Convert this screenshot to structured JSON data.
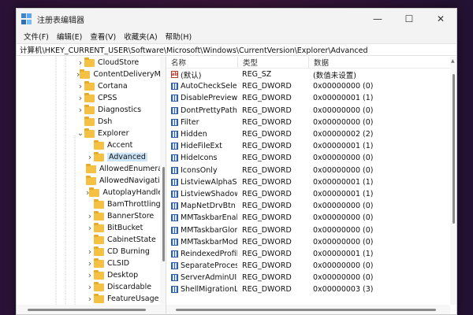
{
  "window": {
    "title": "注册表编辑器",
    "controls": {
      "minimize": "—",
      "maximize": "☐",
      "close": "✕"
    }
  },
  "menu": [
    "文件(F)",
    "编辑(E)",
    "查看(V)",
    "收藏夹(A)",
    "帮助(H)"
  ],
  "address": "计算机\\HKEY_CURRENT_USER\\Software\\Microsoft\\Windows\\CurrentVersion\\Explorer\\Advanced",
  "tree": [
    {
      "label": "CloudStore",
      "level": 0,
      "chevron": "right"
    },
    {
      "label": "ContentDeliveryManager",
      "level": 0,
      "chevron": "right"
    },
    {
      "label": "Cortana",
      "level": 0,
      "chevron": "right"
    },
    {
      "label": "CPSS",
      "level": 0,
      "chevron": "right"
    },
    {
      "label": "Diagnostics",
      "level": 0,
      "chevron": "right"
    },
    {
      "label": "Dsh",
      "level": 0,
      "chevron": "none"
    },
    {
      "label": "Explorer",
      "level": 0,
      "chevron": "down"
    },
    {
      "label": "Accent",
      "level": 1,
      "chevron": "none"
    },
    {
      "label": "Advanced",
      "level": 1,
      "chevron": "right",
      "selected": true
    },
    {
      "label": "AllowedEnumeration",
      "level": 1,
      "chevron": "none"
    },
    {
      "label": "AllowedNavigation",
      "level": 1,
      "chevron": "none"
    },
    {
      "label": "AutoplayHandlers",
      "level": 1,
      "chevron": "right"
    },
    {
      "label": "BamThrottling",
      "level": 1,
      "chevron": "none"
    },
    {
      "label": "BannerStore",
      "level": 1,
      "chevron": "right"
    },
    {
      "label": "BitBucket",
      "level": 1,
      "chevron": "right"
    },
    {
      "label": "CabinetState",
      "level": 1,
      "chevron": "none"
    },
    {
      "label": "CD Burning",
      "level": 1,
      "chevron": "right"
    },
    {
      "label": "CLSID",
      "level": 1,
      "chevron": "right"
    },
    {
      "label": "Desktop",
      "level": 1,
      "chevron": "right"
    },
    {
      "label": "Discardable",
      "level": 1,
      "chevron": "right"
    },
    {
      "label": "FeatureUsage",
      "level": 1,
      "chevron": "right"
    }
  ],
  "list": {
    "headers": {
      "name": "名称",
      "type": "类型",
      "data": "数据"
    },
    "rows": [
      {
        "name": "(默认)",
        "type": "REG_SZ",
        "data": "(数值未设置)",
        "kind": "sz"
      },
      {
        "name": "AutoCheckSelect",
        "type": "REG_DWORD",
        "data": "0x00000000 (0)",
        "kind": "dword"
      },
      {
        "name": "DisablePreviewDesktop",
        "type": "REG_DWORD",
        "data": "0x00000001 (1)",
        "kind": "dword"
      },
      {
        "name": "DontPrettyPath",
        "type": "REG_DWORD",
        "data": "0x00000000 (0)",
        "kind": "dword"
      },
      {
        "name": "Filter",
        "type": "REG_DWORD",
        "data": "0x00000000 (0)",
        "kind": "dword"
      },
      {
        "name": "Hidden",
        "type": "REG_DWORD",
        "data": "0x00000002 (2)",
        "kind": "dword"
      },
      {
        "name": "HideFileExt",
        "type": "REG_DWORD",
        "data": "0x00000001 (1)",
        "kind": "dword"
      },
      {
        "name": "HideIcons",
        "type": "REG_DWORD",
        "data": "0x00000000 (0)",
        "kind": "dword"
      },
      {
        "name": "IconsOnly",
        "type": "REG_DWORD",
        "data": "0x00000000 (0)",
        "kind": "dword"
      },
      {
        "name": "ListviewAlphaSelect",
        "type": "REG_DWORD",
        "data": "0x00000001 (1)",
        "kind": "dword"
      },
      {
        "name": "ListviewShadow",
        "type": "REG_DWORD",
        "data": "0x00000001 (1)",
        "kind": "dword"
      },
      {
        "name": "MapNetDrvBtn",
        "type": "REG_DWORD",
        "data": "0x00000000 (0)",
        "kind": "dword"
      },
      {
        "name": "MMTaskbarEnabled",
        "type": "REG_DWORD",
        "data": "0x00000000 (0)",
        "kind": "dword"
      },
      {
        "name": "MMTaskbarGlomLevel",
        "type": "REG_DWORD",
        "data": "0x00000000 (0)",
        "kind": "dword"
      },
      {
        "name": "MMTaskbarMode",
        "type": "REG_DWORD",
        "data": "0x00000000 (0)",
        "kind": "dword"
      },
      {
        "name": "ReindexedProfile",
        "type": "REG_DWORD",
        "data": "0x00000001 (1)",
        "kind": "dword"
      },
      {
        "name": "SeparateProcess",
        "type": "REG_DWORD",
        "data": "0x00000000 (0)",
        "kind": "dword"
      },
      {
        "name": "ServerAdminUI",
        "type": "REG_DWORD",
        "data": "0x00000000 (0)",
        "kind": "dword"
      },
      {
        "name": "ShellMigrationLevel",
        "type": "REG_DWORD",
        "data": "0x00000003 (3)",
        "kind": "dword"
      }
    ]
  }
}
